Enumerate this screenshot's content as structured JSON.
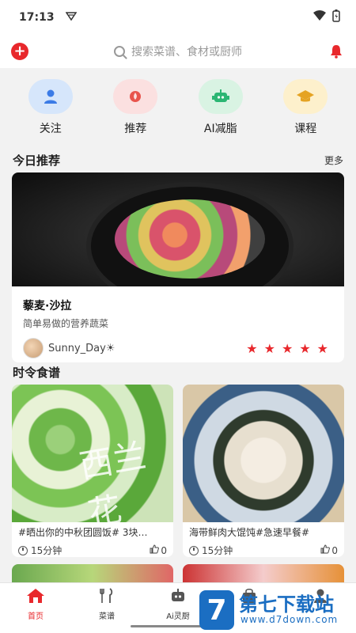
{
  "status_bar": {
    "time": "17:13"
  },
  "header": {
    "search_placeholder": "搜索菜谱、食材或厨师"
  },
  "quick_nav": [
    {
      "label": "关注",
      "icon": "user-icon",
      "bg": "#d6e6fb",
      "color": "#3b7be6"
    },
    {
      "label": "推荐",
      "icon": "flame-icon",
      "bg": "#fbe0e0",
      "color": "#e8544c"
    },
    {
      "label": "AI减脂",
      "icon": "robot-icon",
      "bg": "#d9f3e3",
      "color": "#2bb673"
    },
    {
      "label": "课程",
      "icon": "graduation-cap-icon",
      "bg": "#fdf0cc",
      "color": "#e5a323"
    }
  ],
  "today": {
    "title": "今日推荐",
    "more": "更多"
  },
  "featured": {
    "title": "藜麦·沙拉",
    "subtitle": "简单易做的营养蔬菜",
    "author": "Sunny_Day☀",
    "rating": 5
  },
  "seasonal": {
    "title": "时令食谱"
  },
  "cards": [
    {
      "title": "#晒出你的中秋团圆饭# 3块…",
      "time": "15分钟",
      "likes": "0",
      "overlay": "西兰花"
    },
    {
      "title": "海带鲜肉大馄饨#急速早餐#",
      "time": "15分钟",
      "likes": "0"
    }
  ],
  "tabs": [
    {
      "label": "首页",
      "icon": "home-icon",
      "active": true
    },
    {
      "label": "菜谱",
      "icon": "fork-knife-icon"
    },
    {
      "label": "Ai灵厨",
      "icon": "robot-icon"
    },
    {
      "label": "",
      "icon": "bag-icon"
    },
    {
      "label": "",
      "icon": "profile-icon"
    }
  ],
  "watermark": {
    "logo": "7",
    "title": "第七下载站",
    "url": "www.d7down.com"
  },
  "colors": {
    "accent": "#e8282c",
    "star": "#e8282c"
  }
}
